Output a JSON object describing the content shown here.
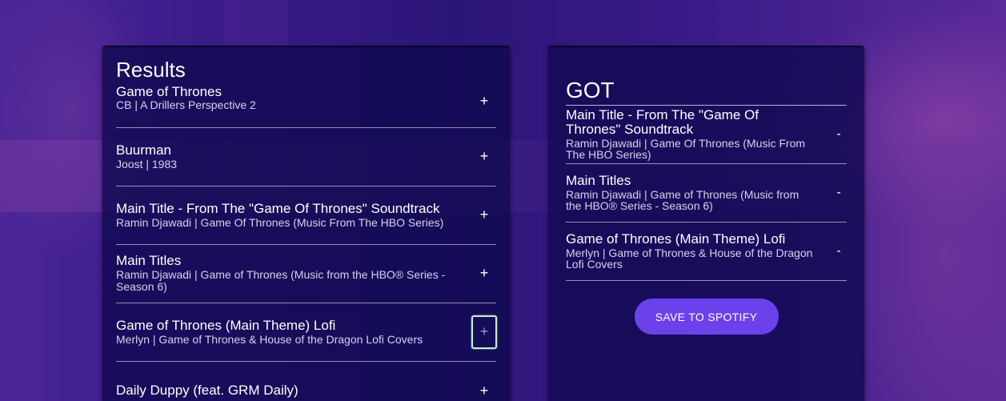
{
  "results": {
    "title": "Results",
    "tracks": [
      {
        "name": "Game of Thrones",
        "meta": "CB | A Drillers Perspective 2",
        "action": "+"
      },
      {
        "name": "Buurman",
        "meta": "Joost | 1983",
        "action": "+"
      },
      {
        "name": "Main Title - From The \"Game Of Thrones\" Soundtrack",
        "meta": "Ramin Djawadi | Game Of Thrones (Music From The HBO Series)",
        "action": "+"
      },
      {
        "name": "Main Titles",
        "meta": "Ramin Djawadi | Game of Thrones (Music from the HBO® Series - Season 6)",
        "action": "+"
      },
      {
        "name": "Game of Thrones (Main Theme) Lofi",
        "meta": "Merlyn | Game of Thrones & House of the Dragon Lofi Covers",
        "action": "+"
      },
      {
        "name": "Daily Duppy (feat. GRM Daily)",
        "meta": "",
        "action": "+"
      }
    ]
  },
  "playlist": {
    "name": "GOT",
    "tracks": [
      {
        "name": "Main Title - From The \"Game Of Thrones\" Soundtrack",
        "meta": "Ramin Djawadi | Game Of Thrones (Music From The HBO Series)",
        "action": "-"
      },
      {
        "name": "Main Titles",
        "meta": "Ramin Djawadi | Game of Thrones (Music from the HBO® Series - Season 6)",
        "action": "-"
      },
      {
        "name": "Game of Thrones (Main Theme) Lofi",
        "meta": "Merlyn | Game of Thrones & House of the Dragon Lofi Covers",
        "action": "-"
      }
    ],
    "save_label": "SAVE TO SPOTIFY"
  },
  "colors": {
    "accent": "#6c41ec",
    "panel": "#100a50",
    "focus_ring": "#c9f1c9"
  }
}
